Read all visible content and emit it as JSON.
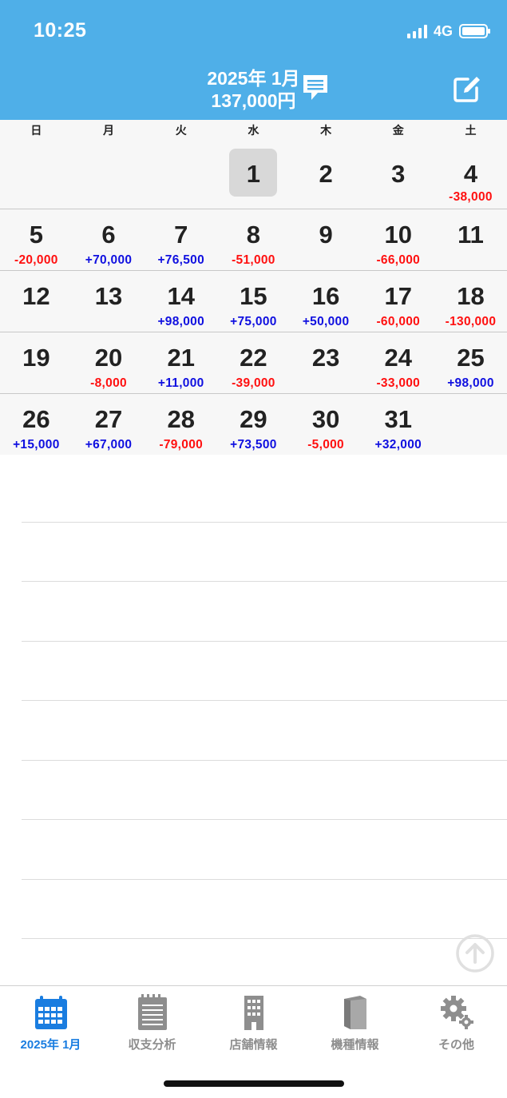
{
  "status": {
    "time": "10:25",
    "network": "4G"
  },
  "header": {
    "month": "2025年 1月",
    "total": "137,000円"
  },
  "weekdays": [
    "日",
    "月",
    "火",
    "水",
    "木",
    "金",
    "土"
  ],
  "calendar": {
    "today": "1",
    "weeks": [
      [
        {
          "day": "",
          "amount": ""
        },
        {
          "day": "",
          "amount": ""
        },
        {
          "day": "",
          "amount": ""
        },
        {
          "day": "1",
          "amount": ""
        },
        {
          "day": "2",
          "amount": ""
        },
        {
          "day": "3",
          "amount": ""
        },
        {
          "day": "4",
          "amount": "-38,000"
        }
      ],
      [
        {
          "day": "5",
          "amount": "-20,000"
        },
        {
          "day": "6",
          "amount": "+70,000"
        },
        {
          "day": "7",
          "amount": "+76,500"
        },
        {
          "day": "8",
          "amount": "-51,000"
        },
        {
          "day": "9",
          "amount": ""
        },
        {
          "day": "10",
          "amount": "-66,000"
        },
        {
          "day": "11",
          "amount": ""
        }
      ],
      [
        {
          "day": "12",
          "amount": ""
        },
        {
          "day": "13",
          "amount": ""
        },
        {
          "day": "14",
          "amount": "+98,000"
        },
        {
          "day": "15",
          "amount": "+75,000"
        },
        {
          "day": "16",
          "amount": "+50,000"
        },
        {
          "day": "17",
          "amount": "-60,000"
        },
        {
          "day": "18",
          "amount": "-130,000"
        }
      ],
      [
        {
          "day": "19",
          "amount": ""
        },
        {
          "day": "20",
          "amount": "-8,000"
        },
        {
          "day": "21",
          "amount": "+11,000"
        },
        {
          "day": "22",
          "amount": "-39,000"
        },
        {
          "day": "23",
          "amount": ""
        },
        {
          "day": "24",
          "amount": "-33,000"
        },
        {
          "day": "25",
          "amount": "+98,000"
        }
      ],
      [
        {
          "day": "26",
          "amount": "+15,000"
        },
        {
          "day": "27",
          "amount": "+67,000"
        },
        {
          "day": "28",
          "amount": "-79,000"
        },
        {
          "day": "29",
          "amount": "+73,500"
        },
        {
          "day": "30",
          "amount": "-5,000"
        },
        {
          "day": "31",
          "amount": "+32,000"
        },
        {
          "day": "",
          "amount": ""
        }
      ]
    ]
  },
  "colors": {
    "header": "#4fafe8",
    "positive": "#1010e0",
    "negative": "#ff1010",
    "active_tab": "#1a7de0",
    "inactive_tab": "#8e8e8e"
  },
  "tabs": [
    {
      "label": "2025年 1月",
      "icon": "calendar-icon",
      "active": true
    },
    {
      "label": "収支分析",
      "icon": "notepad-icon",
      "active": false
    },
    {
      "label": "店舗情報",
      "icon": "building-icon",
      "active": false
    },
    {
      "label": "機種情報",
      "icon": "book-icon",
      "active": false
    },
    {
      "label": "その他",
      "icon": "gear-icon",
      "active": false
    }
  ]
}
